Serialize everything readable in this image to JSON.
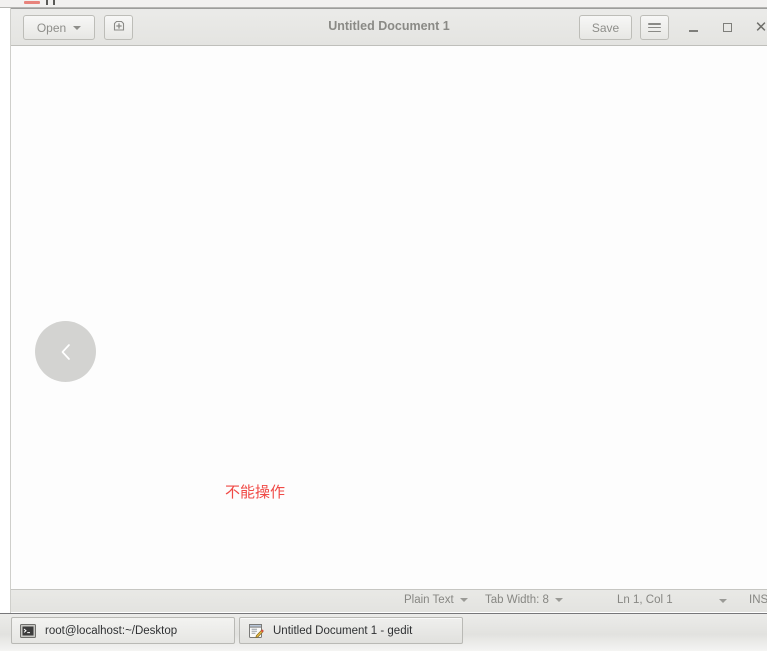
{
  "window": {
    "title": "Untitled Document 1",
    "toolbar": {
      "open_label": "Open",
      "open_icon": "chevron-down-icon",
      "new_document_icon": "new-document-icon",
      "save_label": "Save",
      "menu_icon": "hamburger-menu-icon"
    },
    "controls": {
      "minimize_icon": "minimize-icon",
      "maximize_icon": "maximize-icon",
      "close_icon": "close-icon"
    }
  },
  "document": {
    "content": "",
    "overlay_button_icon": "chevron-left-icon",
    "annotation_text": "不能操作",
    "annotation_color": "#f04a46"
  },
  "statusbar": {
    "language": "Plain Text",
    "tab_width": "Tab Width: 8",
    "position": "Ln 1, Col 1",
    "dropdown_icon": "chevron-down-icon",
    "insert_mode": "INS"
  },
  "taskbar": {
    "items": [
      {
        "label": "root@localhost:~/Desktop",
        "icon": "terminal-icon"
      },
      {
        "label": "Untitled Document 1 - gedit",
        "icon": "gedit-icon"
      }
    ]
  }
}
